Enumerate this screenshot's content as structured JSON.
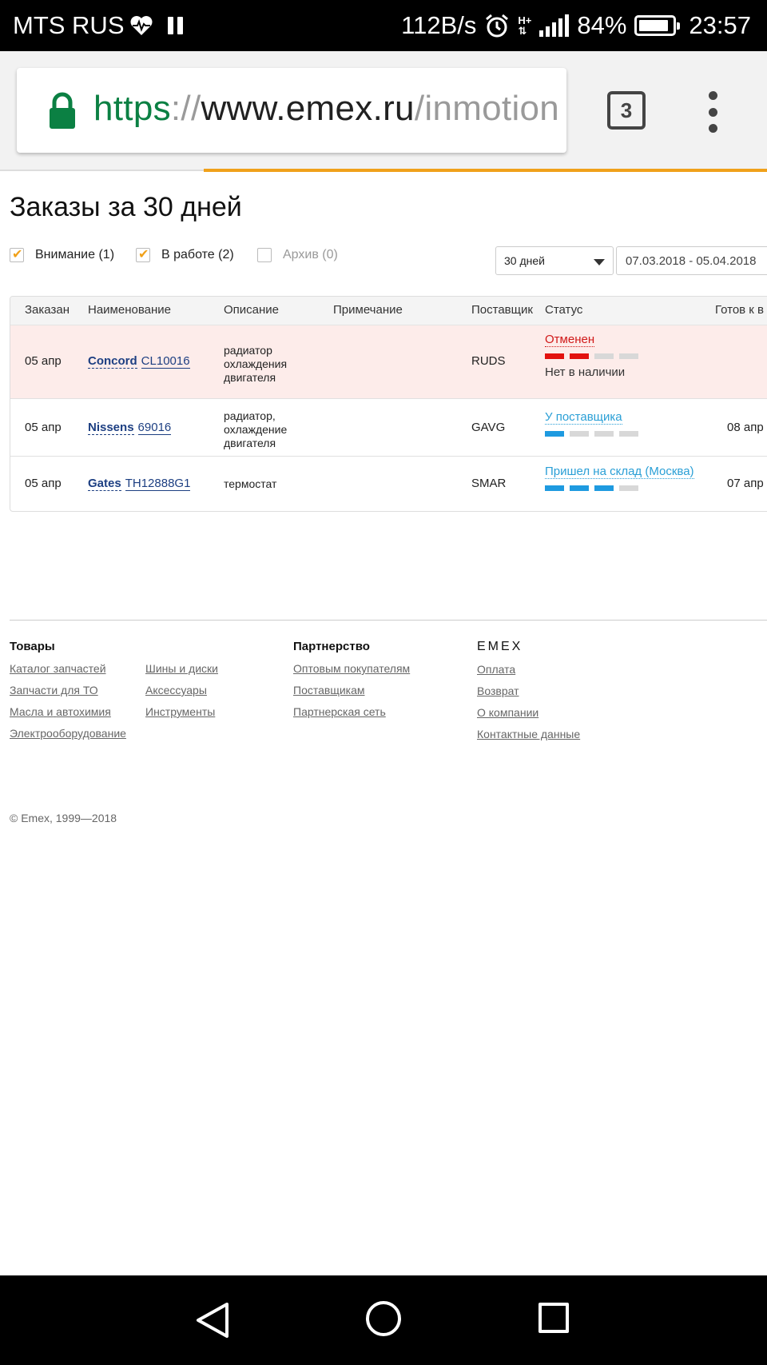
{
  "statusbar": {
    "carrier": "MTS RUS",
    "speed": "112B/s",
    "battery": "84%",
    "time": "23:57",
    "icons": [
      "heart-pulse-icon",
      "pause-icon",
      "alarm-icon",
      "hplus-network-icon",
      "signal-icon",
      "battery-icon"
    ]
  },
  "browser": {
    "url_scheme": "https",
    "url_sep": "://",
    "url_host": "www.emex.ru",
    "url_path": "/inmotion",
    "tab_count": "3",
    "accent": "#f0a11a",
    "secure_color": "#0b8043"
  },
  "page": {
    "title": "Заказы за 30 дней"
  },
  "filters": {
    "attention": "Внимание (1)",
    "in_work": "В работе (2)",
    "archive": "Архив (0)",
    "period": "30 дней",
    "date_range": "07.03.2018 - 05.04.2018"
  },
  "table": {
    "headers": {
      "ordered": "Заказан",
      "name": "Наименование",
      "description": "Описание",
      "note": "Примечание",
      "supplier": "Поставщик",
      "status": "Статус",
      "ready": "Готов к в"
    },
    "rows": [
      {
        "ordered": "05 апр",
        "brand": "Concord",
        "part": "CL10016",
        "description": "радиатор охлаждения двигателя",
        "note": "",
        "supplier": "RUDS",
        "status": "Отменен",
        "substatus": "Нет в наличии",
        "ready": "",
        "stages_done": 2,
        "stages_total": 4,
        "status_color": "#d01818"
      },
      {
        "ordered": "05 апр",
        "brand": "Nissens",
        "part": "69016",
        "description": "радиатор, охлаждение двигателя",
        "note": "",
        "supplier": "GAVG",
        "status": "У поставщика",
        "substatus": "",
        "ready": "08 апр",
        "stages_done": 1,
        "stages_total": 4,
        "status_color": "#2a9fd6"
      },
      {
        "ordered": "05 апр",
        "brand": "Gates",
        "part": "TH12888G1",
        "description": "термостат",
        "note": "",
        "supplier": "SMAR",
        "status": "Пришел на склад (Москва)",
        "substatus": "",
        "ready": "07 апр",
        "stages_done": 3,
        "stages_total": 4,
        "status_color": "#2a9fd6"
      }
    ]
  },
  "footer": {
    "goods": {
      "title": "Товары",
      "col1": [
        "Каталог запчастей",
        "Запчасти для ТО",
        "Масла",
        "и",
        "автохимия",
        "Электрооборудование"
      ],
      "col2": [
        "Шины и диски",
        "Аксессуары",
        "Инструменты"
      ]
    },
    "partnership": {
      "title": "Партнерство",
      "links": [
        "Оптовым покупателям",
        "Поставщикам",
        "Партнерская сеть"
      ]
    },
    "emex": {
      "title": "EMEX",
      "links": [
        "Оплата",
        "Возврат",
        "О компании",
        "Контактные данные"
      ]
    },
    "copyright": "© Emex, 1999—2018"
  }
}
